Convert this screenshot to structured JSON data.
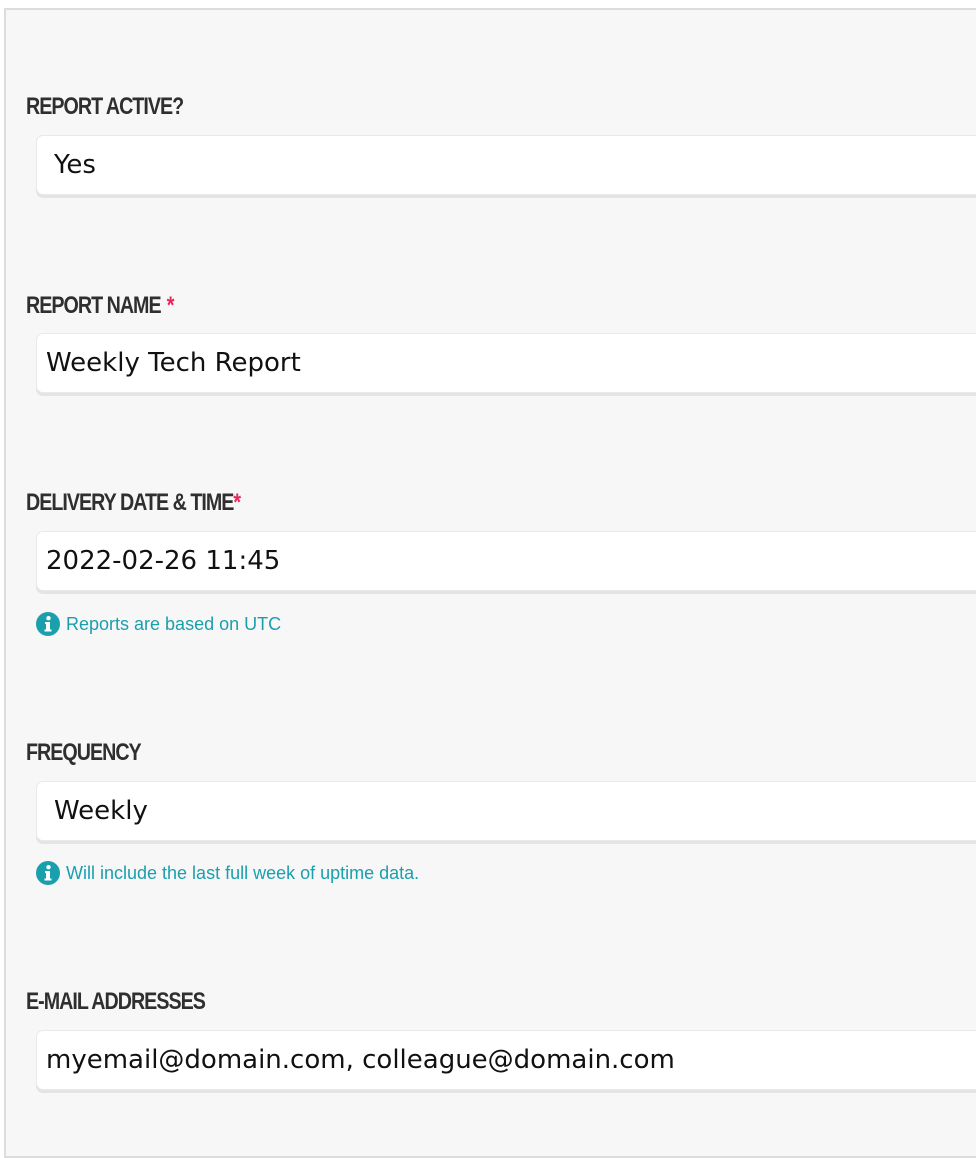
{
  "form": {
    "report_active": {
      "label": "REPORT ACTIVE?",
      "value": "Yes"
    },
    "report_name": {
      "label": "REPORT NAME",
      "required_mark": "*",
      "value": "Weekly Tech Report"
    },
    "delivery": {
      "label": "DELIVERY DATE & TIME",
      "required_mark": "*",
      "value": "2022-02-26 11:45",
      "hint": "Reports are based on UTC"
    },
    "frequency": {
      "label": "FREQUENCY",
      "value": "Weekly",
      "hint": "Will include the last full week of uptime data."
    },
    "emails": {
      "label": "E-MAIL ADDRESSES",
      "value": "myemail@domain.com, colleague@domain.com"
    }
  },
  "colors": {
    "label": "#2f2f2f",
    "required": "#e8245b",
    "hint": "#1a9fad",
    "panel_bg": "#f7f7f7"
  },
  "icons": {
    "hint_icon": "info-circle-icon"
  }
}
